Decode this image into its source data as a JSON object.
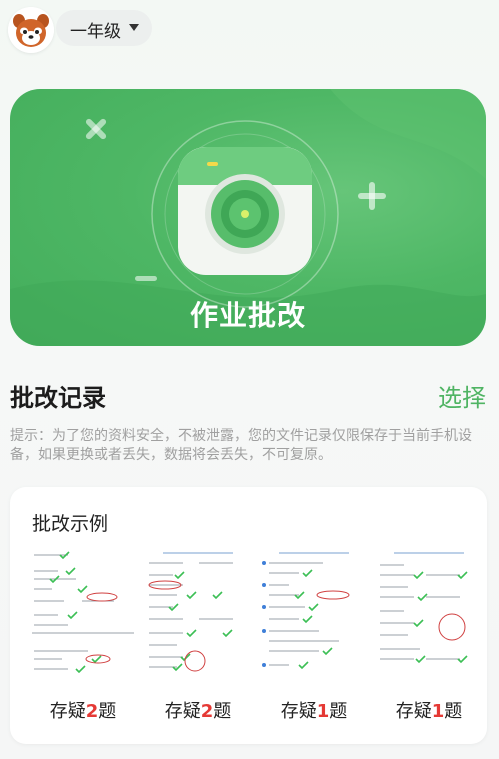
{
  "header": {
    "grade": "一年级"
  },
  "hero": {
    "title": "作业批改"
  },
  "records": {
    "title": "批改记录",
    "select_label": "选择",
    "tip": "提示：为了您的资料安全，不被泄露，您的文件记录仅限保存于当前手机设备，如果更换或者丢失，数据将会丢失，不可复原。"
  },
  "examples": {
    "title": "批改示例",
    "items": [
      {
        "prefix": "存疑",
        "count": "2",
        "suffix": "题"
      },
      {
        "prefix": "存疑",
        "count": "2",
        "suffix": "题"
      },
      {
        "prefix": "存疑",
        "count": "1",
        "suffix": "题"
      },
      {
        "prefix": "存疑",
        "count": "1",
        "suffix": "题"
      }
    ]
  },
  "colors": {
    "brand_green": "#4fb463",
    "doubt_red": "#e53935"
  }
}
